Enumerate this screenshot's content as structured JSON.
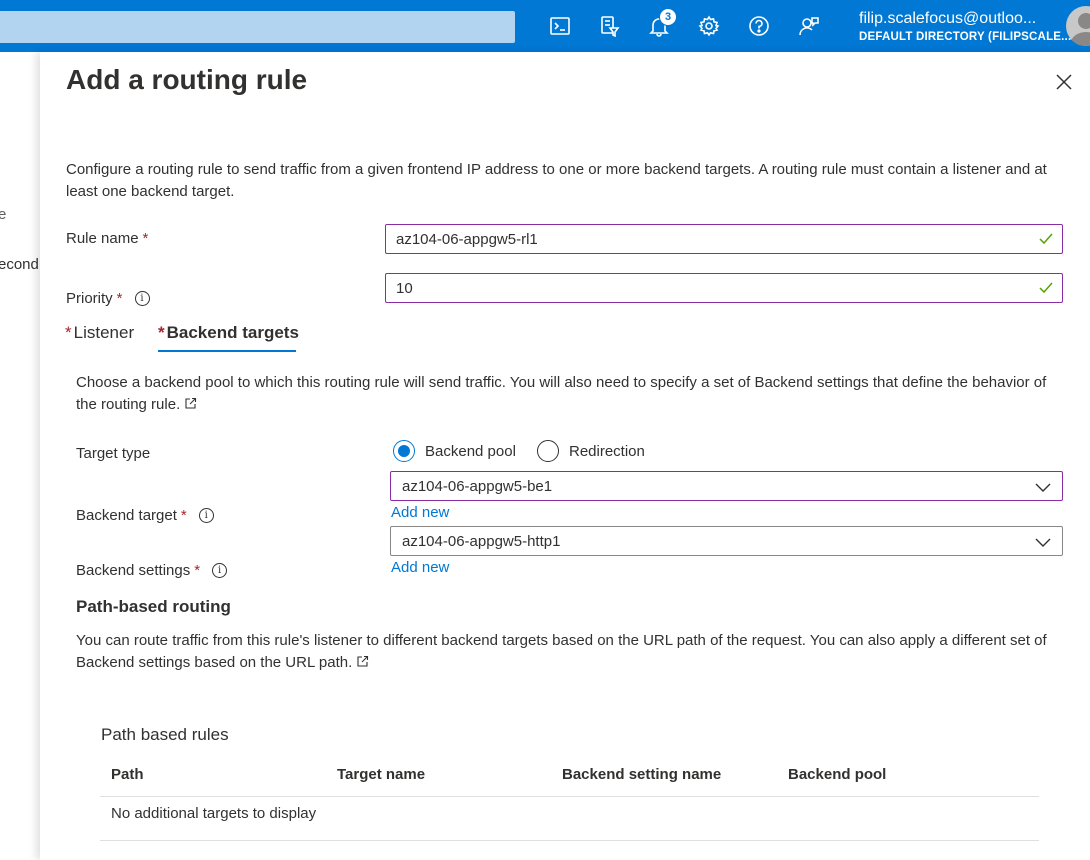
{
  "topbar": {
    "notification_count": "3",
    "account_email": "filip.scalefocus@outloo...",
    "account_directory": "DEFAULT DIRECTORY (FILIPSCALE...",
    "icons": [
      "cloud-shell-icon",
      "directory-filter-icon",
      "notifications-icon",
      "settings-icon",
      "help-icon",
      "feedback-icon"
    ]
  },
  "background": {
    "text1": "e",
    "text2": "econd"
  },
  "panel": {
    "title": "Add a routing rule",
    "description": "Configure a routing rule to send traffic from a given frontend IP address to one or more backend targets. A routing rule must contain a listener and at least one backend target.",
    "rule_name_label": "Rule name",
    "rule_name_value": "az104-06-appgw5-rl1",
    "priority_label": "Priority",
    "priority_value": "10",
    "required_mark": "*",
    "info_glyph": "i",
    "tabs": [
      {
        "label": "Listener",
        "active": false
      },
      {
        "label": "Backend targets",
        "active": true
      }
    ]
  },
  "backend": {
    "description": "Choose a backend pool to which this routing rule will send traffic. You will also need to specify a set of Backend settings that define the behavior of the routing rule.",
    "target_type_label": "Target type",
    "target_type_options": [
      "Backend pool",
      "Redirection"
    ],
    "target_type_selected": "Backend pool",
    "backend_target_label": "Backend target",
    "backend_target_value": "az104-06-appgw5-be1",
    "backend_settings_label": "Backend settings",
    "backend_settings_value": "az104-06-appgw5-http1",
    "add_new_label": "Add new"
  },
  "path_routing": {
    "heading": "Path-based routing",
    "description": "You can route traffic from this rule's listener to different backend targets based on the URL path of the request. You can also apply a different set of Backend settings based on the URL path.",
    "rules_heading": "Path based rules",
    "columns": [
      "Path",
      "Target name",
      "Backend setting name",
      "Backend pool"
    ],
    "empty_message": "No additional targets to display"
  },
  "colors": {
    "azure_blue": "#0078d4",
    "focus_purple": "#8a2da5",
    "required_red": "#a4262c",
    "valid_green": "#57a300"
  }
}
